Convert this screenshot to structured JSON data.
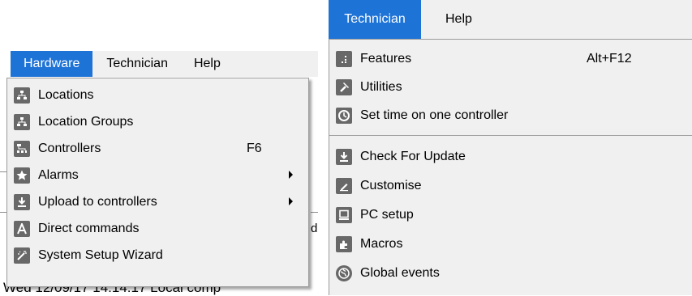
{
  "left_menu": {
    "menubar": [
      {
        "label": "Hardware",
        "active": true
      },
      {
        "label": "Technician",
        "active": false
      },
      {
        "label": "Help",
        "active": false
      }
    ],
    "items": [
      {
        "label": "Locations",
        "icon": "locations-icon"
      },
      {
        "label": "Location Groups",
        "icon": "location-groups-icon"
      },
      {
        "label": "Controllers",
        "icon": "controllers-icon",
        "shortcut": "F6"
      },
      {
        "label": "Alarms",
        "icon": "star-icon",
        "submenu": true
      },
      {
        "label": "Upload to controllers",
        "icon": "download-icon",
        "submenu": true
      },
      {
        "label": "Direct commands",
        "icon": "letter-a-icon"
      },
      {
        "label": "System Setup Wizard",
        "icon": "wand-icon"
      }
    ]
  },
  "right_menu": {
    "menubar": [
      {
        "label": "Technician",
        "active": true
      },
      {
        "label": "Help",
        "active": false
      }
    ],
    "items": [
      {
        "label": "Features",
        "icon": "features-icon",
        "shortcut": "Alt+F12"
      },
      {
        "label": "Utilities",
        "icon": "hammer-icon"
      },
      {
        "label": "Set time on one controller",
        "icon": "clock-icon"
      },
      {
        "label": "Check For Update",
        "icon": "download-icon"
      },
      {
        "label": "Customise",
        "icon": "pencil-icon"
      },
      {
        "label": "PC setup",
        "icon": "monitor-icon"
      },
      {
        "label": "Macros",
        "icon": "puzzle-icon"
      },
      {
        "label": "Global events",
        "icon": "globe-icon"
      }
    ]
  },
  "background": {
    "partial_text": "Wed 12/09/17 14:14:17 Local comp",
    "partial_char": "d"
  },
  "colors": {
    "menubar_bg": "#f0f0f0",
    "active_bg": "#1e73d6",
    "icon_bg": "#686868"
  }
}
